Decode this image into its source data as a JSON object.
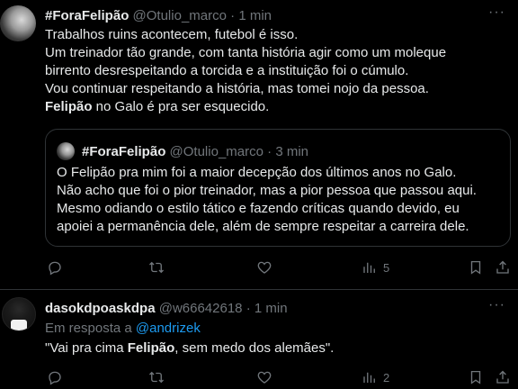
{
  "tweet1": {
    "name": "#ForaFelipão",
    "handle": "@Otulio_marco",
    "dot": "·",
    "time": "1 min",
    "more": "···",
    "lines": [
      "Trabalhos ruins acontecem, futebol é isso.",
      "Um treinador tão grande, com tanta história agir como um moleque",
      "birrento desrespeitando a torcida e a instituição foi o cúmulo.",
      "Vou continuar respeitando a história, mas tomei nojo da pessoa."
    ],
    "last_bold": "Felipão",
    "last_rest": " no Galo é pra ser esquecido.",
    "quote": {
      "name": "#ForaFelipão",
      "handle": "@Otulio_marco",
      "dot": "·",
      "time": "3 min",
      "lines": [
        "O Felipão pra mim foi a maior decepção dos últimos anos no Galo.",
        "Não acho que foi o pior treinador, mas a pior pessoa que passou aqui.",
        "Mesmo odiando o estilo tático e fazendo críticas quando devido, eu",
        "apoiei a permanência dele, além de sempre respeitar a carreira dele."
      ]
    },
    "views_count": "5"
  },
  "tweet2": {
    "name": "dasokdpoaskdpa",
    "handle": "@w66642618",
    "dot": "·",
    "time": "1 min",
    "more": "···",
    "reply_prefix": "Em resposta a ",
    "reply_mention": "@andrizek",
    "text_pre": "\"Vai pra cima ",
    "text_bold": "Felipão",
    "text_post": ", sem medo dos alemães\".",
    "views_count": "2"
  },
  "icons": {
    "reply": "reply-icon",
    "retweet": "retweet-icon",
    "like": "heart-icon",
    "views": "views-icon",
    "bookmark": "bookmark-icon",
    "share": "share-icon"
  },
  "colors": {
    "background": "#000000",
    "text": "#e7e9ea",
    "secondary": "#71767b",
    "link": "#1d9bf0",
    "border": "#2f3336"
  }
}
